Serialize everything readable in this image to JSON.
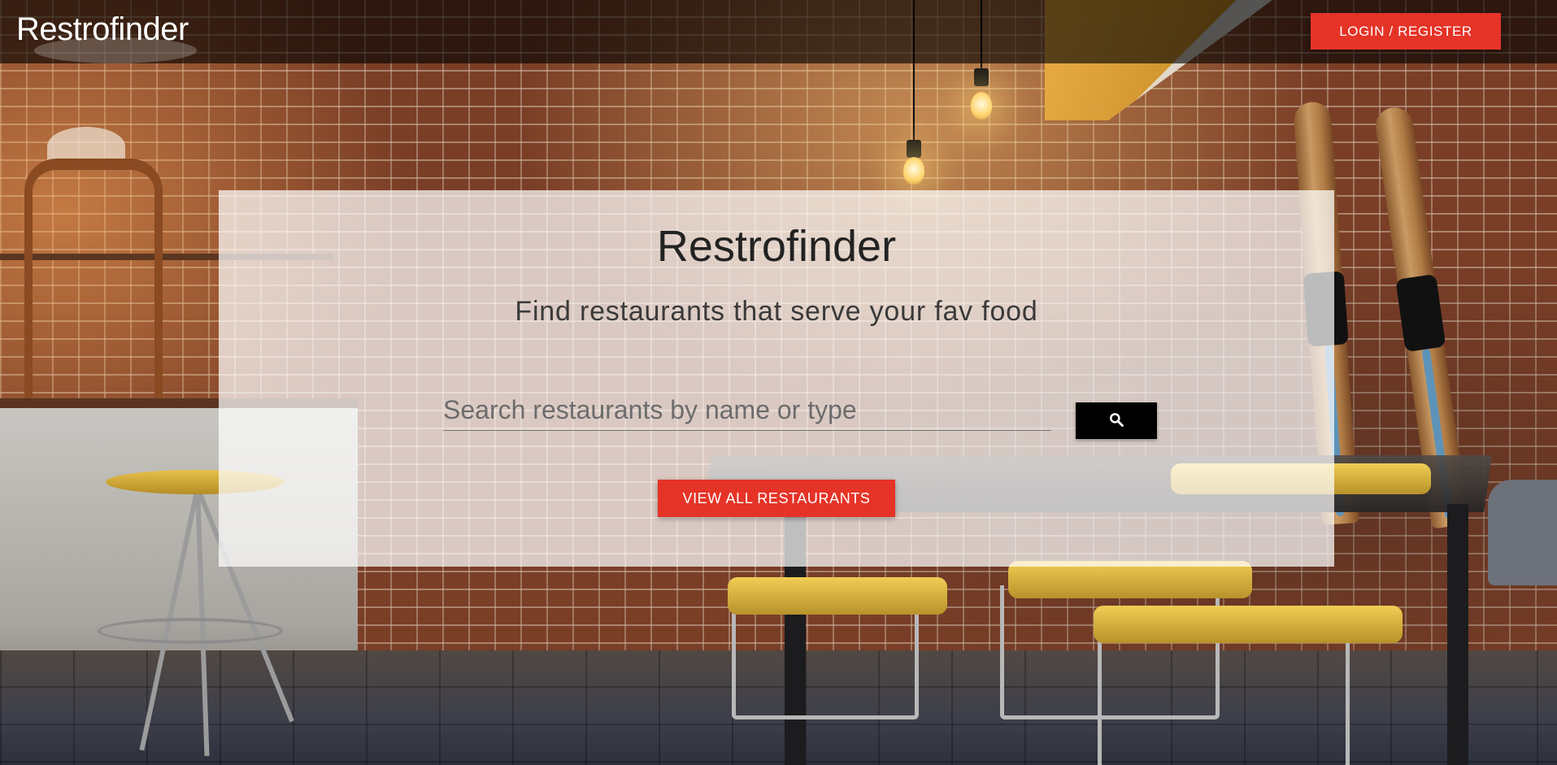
{
  "navbar": {
    "brand": "Restrofinder",
    "login_label": "LOGIN / REGISTER"
  },
  "hero": {
    "title": "Restrofinder",
    "subtitle": "Find restaurants that serve your fav food",
    "search": {
      "placeholder": "Search restaurants by name or type",
      "value": "",
      "button_icon": "search-icon"
    },
    "view_all_label": "VIEW ALL RESTAURANTS"
  },
  "colors": {
    "accent": "#e53327",
    "search_button": "#000000",
    "navbar_bg": "rgba(0,0,0,0.62)",
    "card_bg": "rgba(255,255,255,0.72)"
  }
}
